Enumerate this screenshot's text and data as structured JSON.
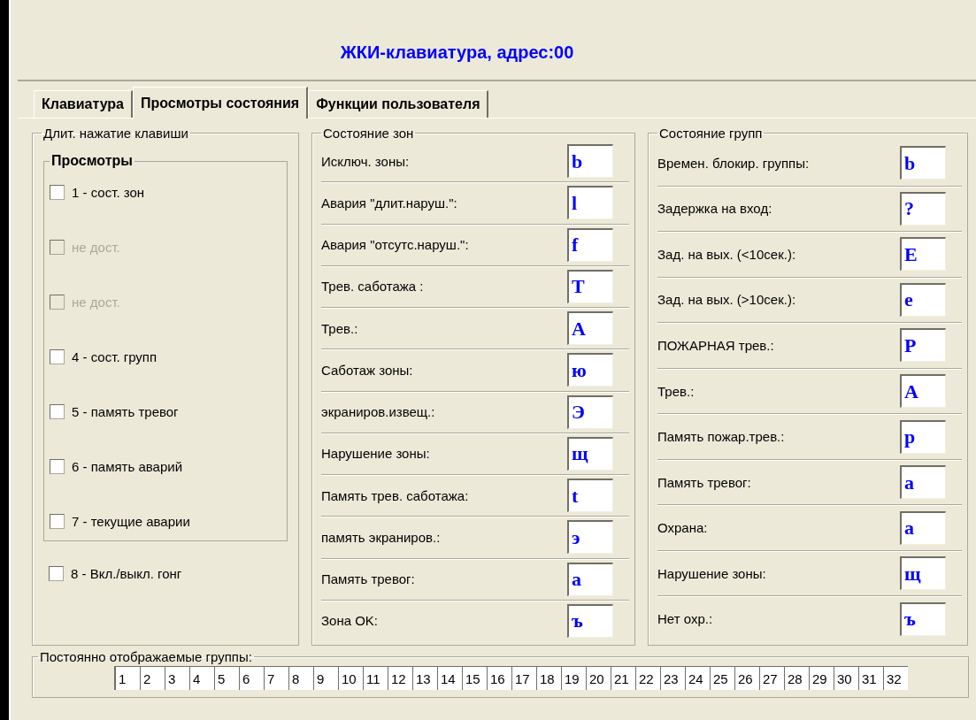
{
  "window": {
    "title": "ЖКИ-клавиатура, адрес:00"
  },
  "tabs": [
    {
      "label": "Клавиатура",
      "selected": false
    },
    {
      "label": "Просмотры состояния",
      "selected": true
    },
    {
      "label": "Функции пользователя",
      "selected": false
    }
  ],
  "long_press": {
    "title": "Длит. нажатие клавиши",
    "views": {
      "title": "Просмотры",
      "items": [
        {
          "label": "1 - сост. зон",
          "checked": false,
          "disabled": false
        },
        {
          "label": "не дост.",
          "checked": false,
          "disabled": true
        },
        {
          "label": "не дост.",
          "checked": false,
          "disabled": true
        },
        {
          "label": "4 - сост. групп",
          "checked": false,
          "disabled": false
        },
        {
          "label": "5 - память тревог",
          "checked": false,
          "disabled": false
        },
        {
          "label": "6 - память аварий",
          "checked": false,
          "disabled": false
        },
        {
          "label": "7 - текущие аварии",
          "checked": false,
          "disabled": false
        }
      ]
    },
    "extra": {
      "label": "8 - Вкл./выкл. гонг",
      "checked": false,
      "disabled": false
    }
  },
  "zone_states": {
    "title": "Состояние зон",
    "rows": [
      {
        "label": "Исключ. зоны:",
        "value": "b"
      },
      {
        "label": "Авария \"длит.наруш.\":",
        "value": "l"
      },
      {
        "label": "Авария \"отсутс.наруш.\":",
        "value": "f"
      },
      {
        "label": "Трев. саботажа :",
        "value": "T"
      },
      {
        "label": "Трев.:",
        "value": "A"
      },
      {
        "label": "Саботаж зоны:",
        "value": "ю"
      },
      {
        "label": "экраниров.извещ.:",
        "value": "Э"
      },
      {
        "label": "Нарушение зоны:",
        "value": "щ"
      },
      {
        "label": "Память трев. саботажа:",
        "value": "t"
      },
      {
        "label": "память экраниров.:",
        "value": "э"
      },
      {
        "label": "Память тревог:",
        "value": "a"
      },
      {
        "label": "Зона OK:",
        "value": "ъ"
      }
    ]
  },
  "group_states": {
    "title": "Состояние групп",
    "rows": [
      {
        "label": "Времен. блокир. группы:",
        "value": "b"
      },
      {
        "label": "Задержка на вход:",
        "value": "?"
      },
      {
        "label": "Зад. на вых. (<10сек.):",
        "value": "E"
      },
      {
        "label": "Зад. на вых. (>10сек.):",
        "value": "e"
      },
      {
        "label": "ПОЖАРНАЯ трев.:",
        "value": "P"
      },
      {
        "label": "Трев.:",
        "value": "A"
      },
      {
        "label": "Память пожар.трев.:",
        "value": "p"
      },
      {
        "label": "Память тревог:",
        "value": "a"
      },
      {
        "label": "Охрана:",
        "value": "a"
      },
      {
        "label": "Нарушение зоны:",
        "value": "щ"
      },
      {
        "label": "Нет охр.:",
        "value": "ъ"
      }
    ]
  },
  "permanent_groups": {
    "title": "Постоянно отображаемые группы:",
    "cells": [
      "1",
      "2",
      "3",
      "4",
      "5",
      "6",
      "7",
      "8",
      "9",
      "10",
      "11",
      "12",
      "13",
      "14",
      "15",
      "16",
      "17",
      "18",
      "19",
      "20",
      "21",
      "22",
      "23",
      "24",
      "25",
      "26",
      "27",
      "28",
      "29",
      "30",
      "31",
      "32"
    ]
  }
}
